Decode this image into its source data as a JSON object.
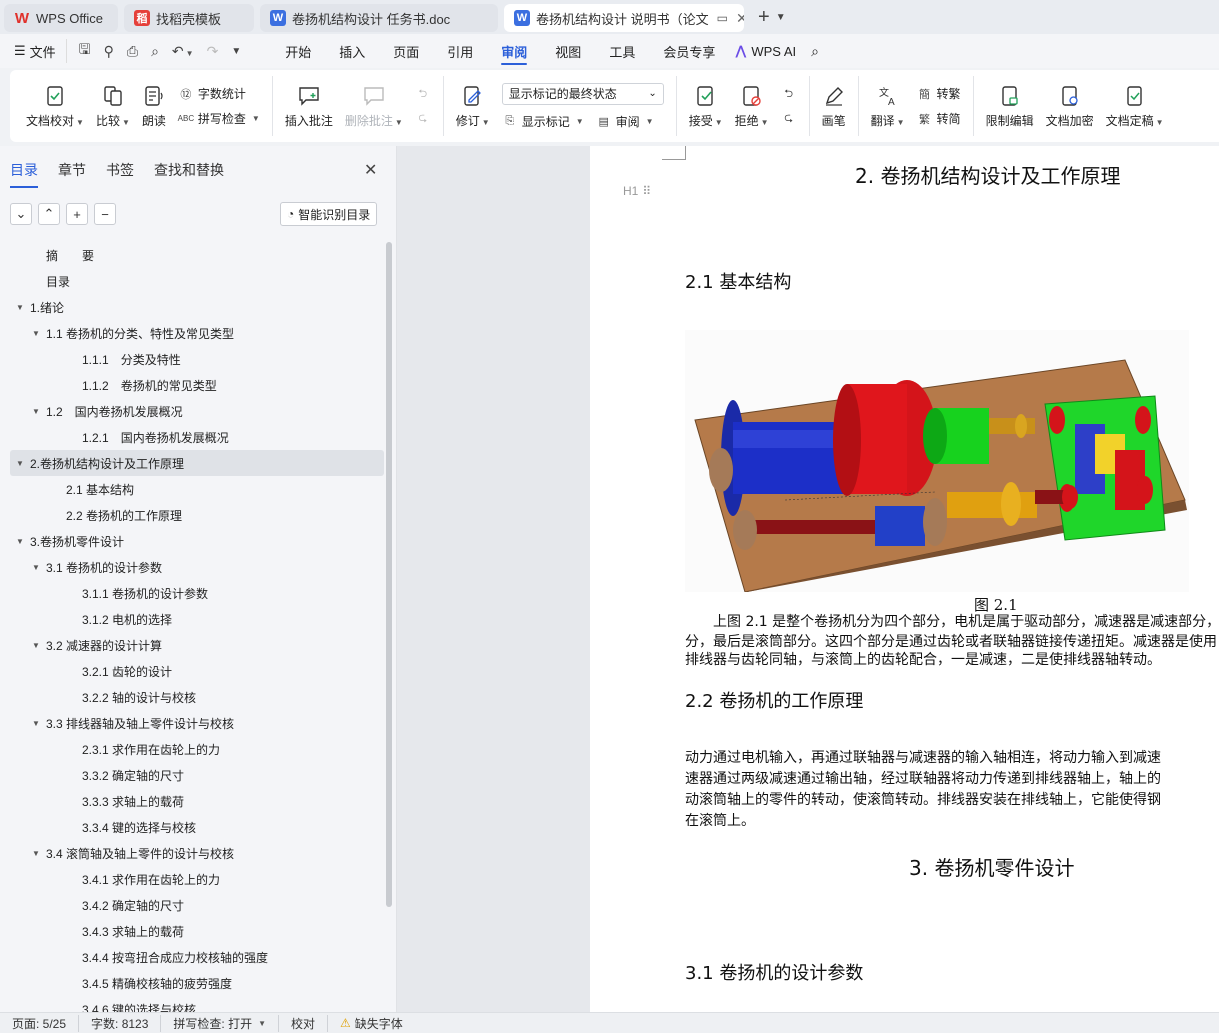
{
  "tabs": [
    {
      "label": "WPS Office",
      "icon": "wps-logo-icon"
    },
    {
      "label": "找稻壳模板",
      "icon": "docer-icon"
    },
    {
      "label": "卷扬机结构设计 任务书.doc",
      "icon": "word-doc-icon"
    },
    {
      "label": "卷扬机结构设计 说明书（论文",
      "icon": "word-doc-icon",
      "active": true
    }
  ],
  "menubar": {
    "file_label": "文件",
    "items": [
      "开始",
      "插入",
      "页面",
      "引用",
      "审阅",
      "视图",
      "工具",
      "会员专享"
    ],
    "active": "审阅",
    "ai_label": "WPS AI"
  },
  "ribbon": {
    "doc_check": "文档校对",
    "compare": "比较",
    "read_aloud": "朗读",
    "word_count": "字数统计",
    "spell_check": "拼写检查",
    "insert_comment": "插入批注",
    "delete_comment": "删除批注",
    "track_changes": "修订",
    "markup_state": "显示标记的最终状态",
    "show_markup": "显示标记",
    "review_pane": "审阅",
    "accept": "接受",
    "reject": "拒绝",
    "pen": "画笔",
    "translate": "翻译",
    "to_traditional": "转繁",
    "to_simplified": "转简",
    "restrict_edit": "限制编辑",
    "encrypt": "文档加密",
    "finalize": "文档定稿"
  },
  "nav": {
    "tabs": [
      "目录",
      "章节",
      "书签",
      "查找和替换"
    ],
    "active_tab": "目录",
    "smart_toc": "智能识别目录",
    "toc": [
      {
        "label": "摘　　要",
        "level": 1,
        "arrow": false
      },
      {
        "label": "目录",
        "level": 1,
        "arrow": false
      },
      {
        "label": "1.绪论",
        "level": 0,
        "arrow": true
      },
      {
        "label": "1.1 卷扬机的分类、特性及常见类型",
        "level": 1,
        "arrow": true
      },
      {
        "label": "1.1.1　分类及特性",
        "level": 3,
        "arrow": false
      },
      {
        "label": "1.1.2　卷扬机的常见类型",
        "level": 3,
        "arrow": false
      },
      {
        "label": "1.2　国内卷扬机发展概况",
        "level": 1,
        "arrow": true
      },
      {
        "label": "1.2.1　国内卷扬机发展概况",
        "level": 3,
        "arrow": false
      },
      {
        "label": "2.卷扬机结构设计及工作原理",
        "level": 0,
        "arrow": true,
        "selected": true
      },
      {
        "label": "2.1  基本结构",
        "level": 2,
        "arrow": false
      },
      {
        "label": "2.2  卷扬机的工作原理",
        "level": 2,
        "arrow": false
      },
      {
        "label": "3.卷扬机零件设计",
        "level": 0,
        "arrow": true
      },
      {
        "label": "3.1  卷扬机的设计参数",
        "level": 1,
        "arrow": true
      },
      {
        "label": "3.1.1  卷扬机的设计参数",
        "level": 3,
        "arrow": false
      },
      {
        "label": "3.1.2  电机的选择",
        "level": 3,
        "arrow": false
      },
      {
        "label": "3.2  减速器的设计计算",
        "level": 1,
        "arrow": true
      },
      {
        "label": "3.2.1 齿轮的设计",
        "level": 3,
        "arrow": false
      },
      {
        "label": "3.2.2  轴的设计与校核",
        "level": 3,
        "arrow": false
      },
      {
        "label": "3.3  排线器轴及轴上零件设计与校核",
        "level": 1,
        "arrow": true
      },
      {
        "label": "2.3.1 求作用在齿轮上的力",
        "level": 3,
        "arrow": false
      },
      {
        "label": "3.3.2  确定轴的尺寸",
        "level": 3,
        "arrow": false
      },
      {
        "label": "3.3.3  求轴上的载荷",
        "level": 3,
        "arrow": false
      },
      {
        "label": "3.3.4  键的选择与校核",
        "level": 3,
        "arrow": false
      },
      {
        "label": "3.4 滚筒轴及轴上零件的设计与校核",
        "level": 1,
        "arrow": true
      },
      {
        "label": "3.4.1  求作用在齿轮上的力",
        "level": 3,
        "arrow": false
      },
      {
        "label": "3.4.2  确定轴的尺寸",
        "level": 3,
        "arrow": false
      },
      {
        "label": "3.4.3  求轴上的载荷",
        "level": 3,
        "arrow": false
      },
      {
        "label": "3.4.4  按弯扭合成应力校核轴的强度",
        "level": 3,
        "arrow": false
      },
      {
        "label": "3.4.5 精确校核轴的疲劳强度",
        "level": 3,
        "arrow": false
      },
      {
        "label": "3.4.6  键的选择与校核",
        "level": 3,
        "arrow": false
      }
    ]
  },
  "doc": {
    "heading_mark": "H1",
    "h_chapter2": "2. 卷扬机结构设计及工作原理",
    "h_2_1": "2.1  基本结构",
    "figure_caption": "图 2.1",
    "para1": [
      "上图 2.1 是整个卷扬机分为四个部分，电机是属于驱动部分，减速器是减速部分，",
      "分，最后是滚筒部分。这四个部分是通过齿轮或者联轴器链接传递扭矩。减速器是使用",
      "排线器与齿轮同轴，与滚筒上的齿轮配合，一是减速，二是使排线器轴转动。"
    ],
    "h_2_2": "2.2  卷扬机的工作原理",
    "para2": [
      "动力通过电机输入，再通过联轴器与减速器的输入轴相连，将动力输入到减速",
      "速器通过两级减速通过输出轴，经过联轴器将动力传递到排线器轴上，轴上的",
      "动滚筒轴上的零件的转动，使滚筒转动。排线器安装在排线轴上，它能使得钢",
      "在滚筒上。"
    ],
    "h_chapter3": "3. 卷扬机零件设计",
    "h_3_1": "3.1  卷扬机的设计参数"
  },
  "status": {
    "page": "页面: 5/25",
    "words": "字数: 8123",
    "spell": "拼写检查: 打开",
    "proof": "校对",
    "missing_font": "缺失字体"
  }
}
